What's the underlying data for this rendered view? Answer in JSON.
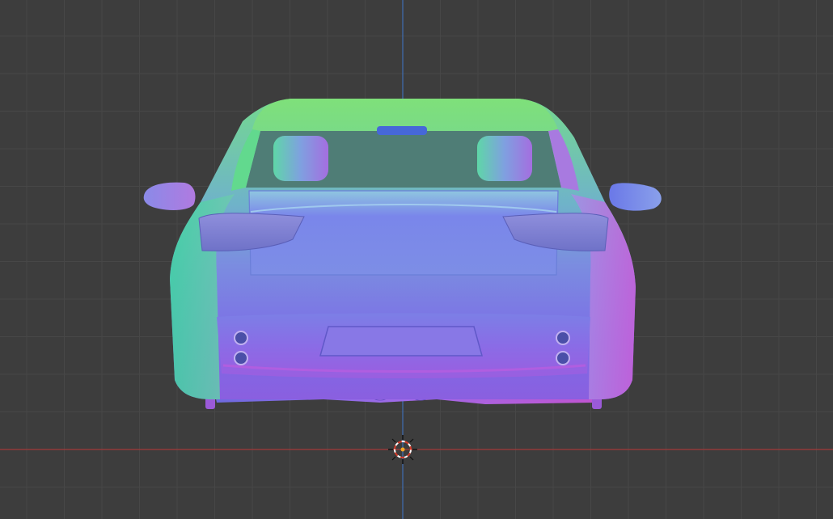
{
  "viewport": {
    "background_color": "#3d3d3d",
    "grid_minor_color": "#474747",
    "grid_major_color": "#4d4d4d",
    "axis_x_color": "#a33a3a",
    "axis_z_color": "#3f6fb3",
    "shading_mode": "normal-map",
    "view": "rear-orthographic"
  },
  "scene": {
    "object": "car",
    "icons": [
      "3d-cursor-icon"
    ]
  }
}
